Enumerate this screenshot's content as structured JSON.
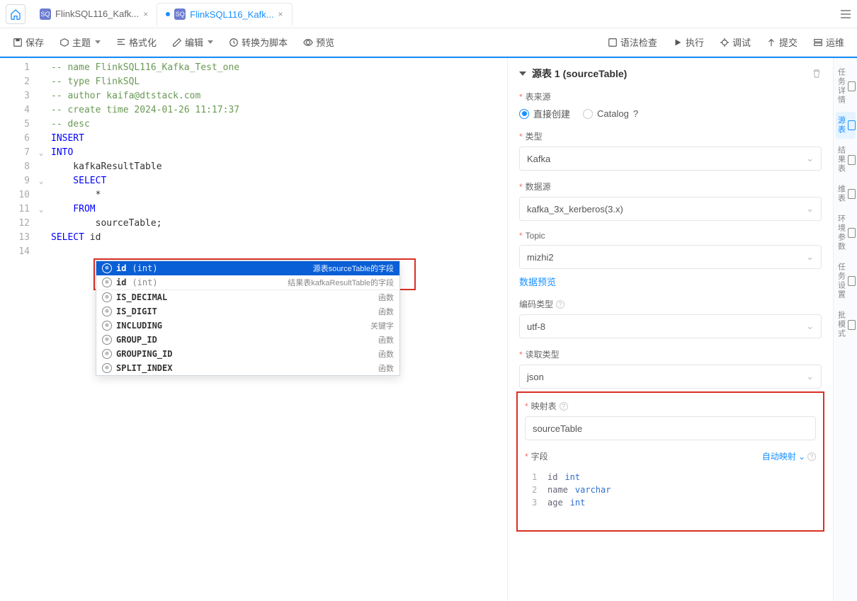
{
  "tabs": [
    {
      "label": "FlinkSQL116_Kafk...",
      "active": false
    },
    {
      "label": "FlinkSQL116_Kafk...",
      "active": true,
      "dirty": true
    }
  ],
  "toolbar": {
    "save": "保存",
    "theme": "主题",
    "format": "格式化",
    "edit": "编辑",
    "to_script": "转换为脚本",
    "preview": "预览",
    "syntax_check": "语法检查",
    "run": "执行",
    "debug": "调试",
    "submit": "提交",
    "ops": "运维"
  },
  "code": {
    "lines": [
      {
        "n": 1,
        "type": "comment",
        "text": "-- name FlinkSQL116_Kafka_Test_one"
      },
      {
        "n": 2,
        "type": "comment",
        "text": "-- type FlinkSQL"
      },
      {
        "n": 3,
        "type": "comment",
        "text": "-- author kaifa@dtstack.com"
      },
      {
        "n": 4,
        "type": "comment",
        "text": "-- create time 2024-01-26 11:17:37"
      },
      {
        "n": 5,
        "type": "comment",
        "text": "-- desc"
      },
      {
        "n": 6,
        "type": "keyword",
        "text": "INSERT"
      },
      {
        "n": 7,
        "type": "keyword",
        "text": "INTO",
        "fold": "v"
      },
      {
        "n": 8,
        "type": "ident",
        "text": "    kafkaResultTable"
      },
      {
        "n": 9,
        "type": "keyword",
        "text": "    SELECT",
        "fold": "v"
      },
      {
        "n": 10,
        "type": "ident",
        "text": "        *"
      },
      {
        "n": 11,
        "type": "keyword",
        "text": "    FROM",
        "fold": "v"
      },
      {
        "n": 12,
        "type": "ident",
        "text": "        sourceTable;"
      },
      {
        "n": 13,
        "type": "ident",
        "text": ""
      },
      {
        "n": 14,
        "type": "mixed",
        "kw": "SELECT",
        "rest": " id"
      }
    ]
  },
  "suggest": {
    "items": [
      {
        "label": "id",
        "type": "(int)",
        "hint": "源表sourceTable的字段",
        "selected": true
      },
      {
        "label": "id",
        "type": "(int)",
        "hint": "结果表kafkaResultTable的字段"
      },
      {
        "label": "IS_DECIMAL",
        "type": "",
        "hint": "函数"
      },
      {
        "label": "IS_DIGIT",
        "type": "",
        "hint": "函数"
      },
      {
        "label": "INCLUDING",
        "type": "",
        "hint": "关键字"
      },
      {
        "label": "GROUP_ID",
        "type": "",
        "hint": "函数"
      },
      {
        "label": "GROUPING_ID",
        "type": "",
        "hint": "函数"
      },
      {
        "label": "SPLIT_INDEX",
        "type": "",
        "hint": "函数"
      }
    ]
  },
  "panel": {
    "title": "源表 1 (sourceTable)",
    "labels": {
      "source_origin": "表来源",
      "radio_direct": "直接创建",
      "radio_catalog": "Catalog",
      "type": "类型",
      "datasource": "数据源",
      "topic": "Topic",
      "topic_preview": "数据预览",
      "encoding": "编码类型",
      "read_type": "读取类型",
      "map_table": "映射表",
      "fields": "字段",
      "auto_map": "自动映射"
    },
    "values": {
      "type": "Kafka",
      "datasource": "kafka_3x_kerberos(3.x)",
      "topic": "mizhi2",
      "encoding": "utf-8",
      "read_type": "json",
      "map_table": "sourceTable"
    },
    "schema": [
      {
        "n": 1,
        "name": "id",
        "type": "int"
      },
      {
        "n": 2,
        "name": "name",
        "type": "varchar"
      },
      {
        "n": 3,
        "name": "age",
        "type": "int"
      }
    ]
  },
  "rail": {
    "items": [
      {
        "name": "task-detail",
        "label": "任务详情"
      },
      {
        "name": "source-table",
        "label": "源表",
        "active": true
      },
      {
        "name": "result-table",
        "label": "结果表"
      },
      {
        "name": "dim-table",
        "label": "维表"
      },
      {
        "name": "env-params",
        "label": "环境参数"
      },
      {
        "name": "task-settings",
        "label": "任务设置"
      },
      {
        "name": "batch-mode",
        "label": "批模式"
      }
    ]
  }
}
